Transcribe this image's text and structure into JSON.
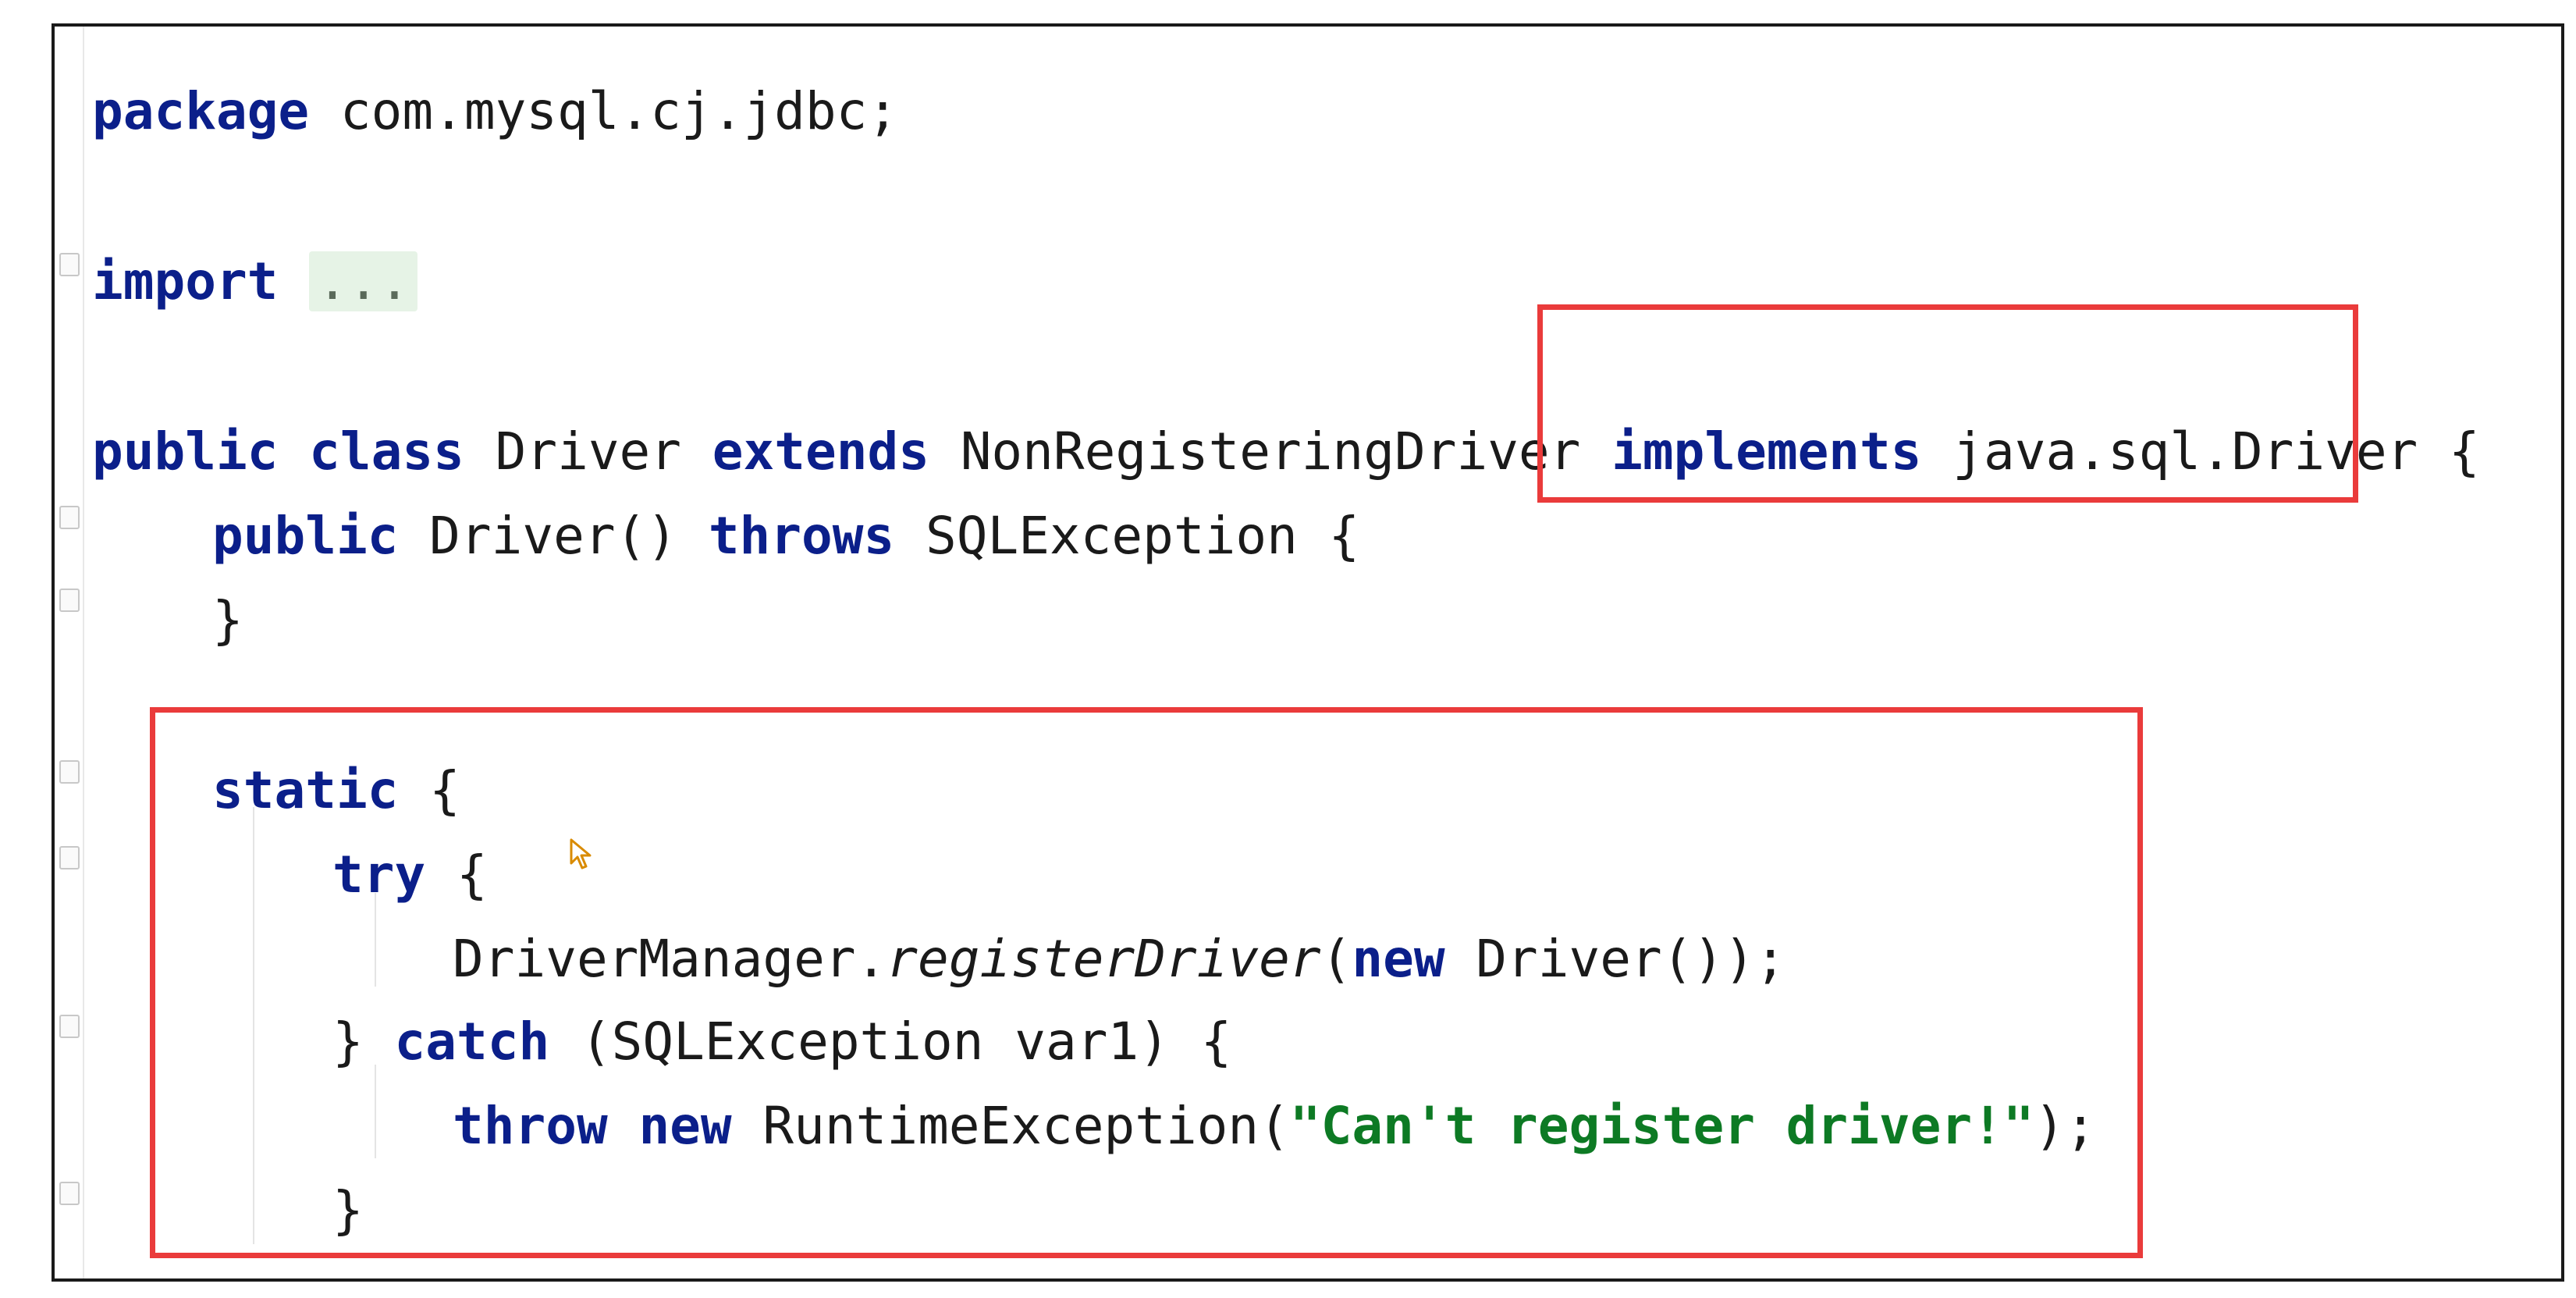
{
  "editor": {
    "lines": {
      "package_kw": "package",
      "package_name": " com.mysql.cj.jdbc;",
      "import_kw": "import",
      "import_fold": "...",
      "class_public": "public",
      "class_class": "class",
      "class_name": "Driver",
      "class_extends": "extends",
      "class_parent": "NonRegisteringDriver",
      "class_implements": "implements",
      "class_interface": "java.sql.Driver",
      "class_brace": "{",
      "ctor_public": "public",
      "ctor_name": "Driver()",
      "ctor_throws": "throws",
      "ctor_exception": "SQLException {",
      "ctor_close": "}",
      "static_kw": "static",
      "static_brace": "{",
      "try_kw": "try",
      "try_brace": "{",
      "register_class": "DriverManager.",
      "register_method": "registerDriver",
      "register_open": "(",
      "register_new": "new",
      "register_arg": " Driver());",
      "catch_close": "}",
      "catch_kw": "catch",
      "catch_args": "(SQLException var1) {",
      "throw_kw": "throw",
      "throw_new": "new",
      "throw_class": " RuntimeException(",
      "throw_msg": "\"Can't register driver!\"",
      "throw_end": ");",
      "catch_end": "}"
    }
  },
  "highlights": {
    "color": "#ea3b3b"
  },
  "colors": {
    "keyword": "#0b1f8a",
    "string": "#0d7a24",
    "text": "#1a1a1a"
  }
}
